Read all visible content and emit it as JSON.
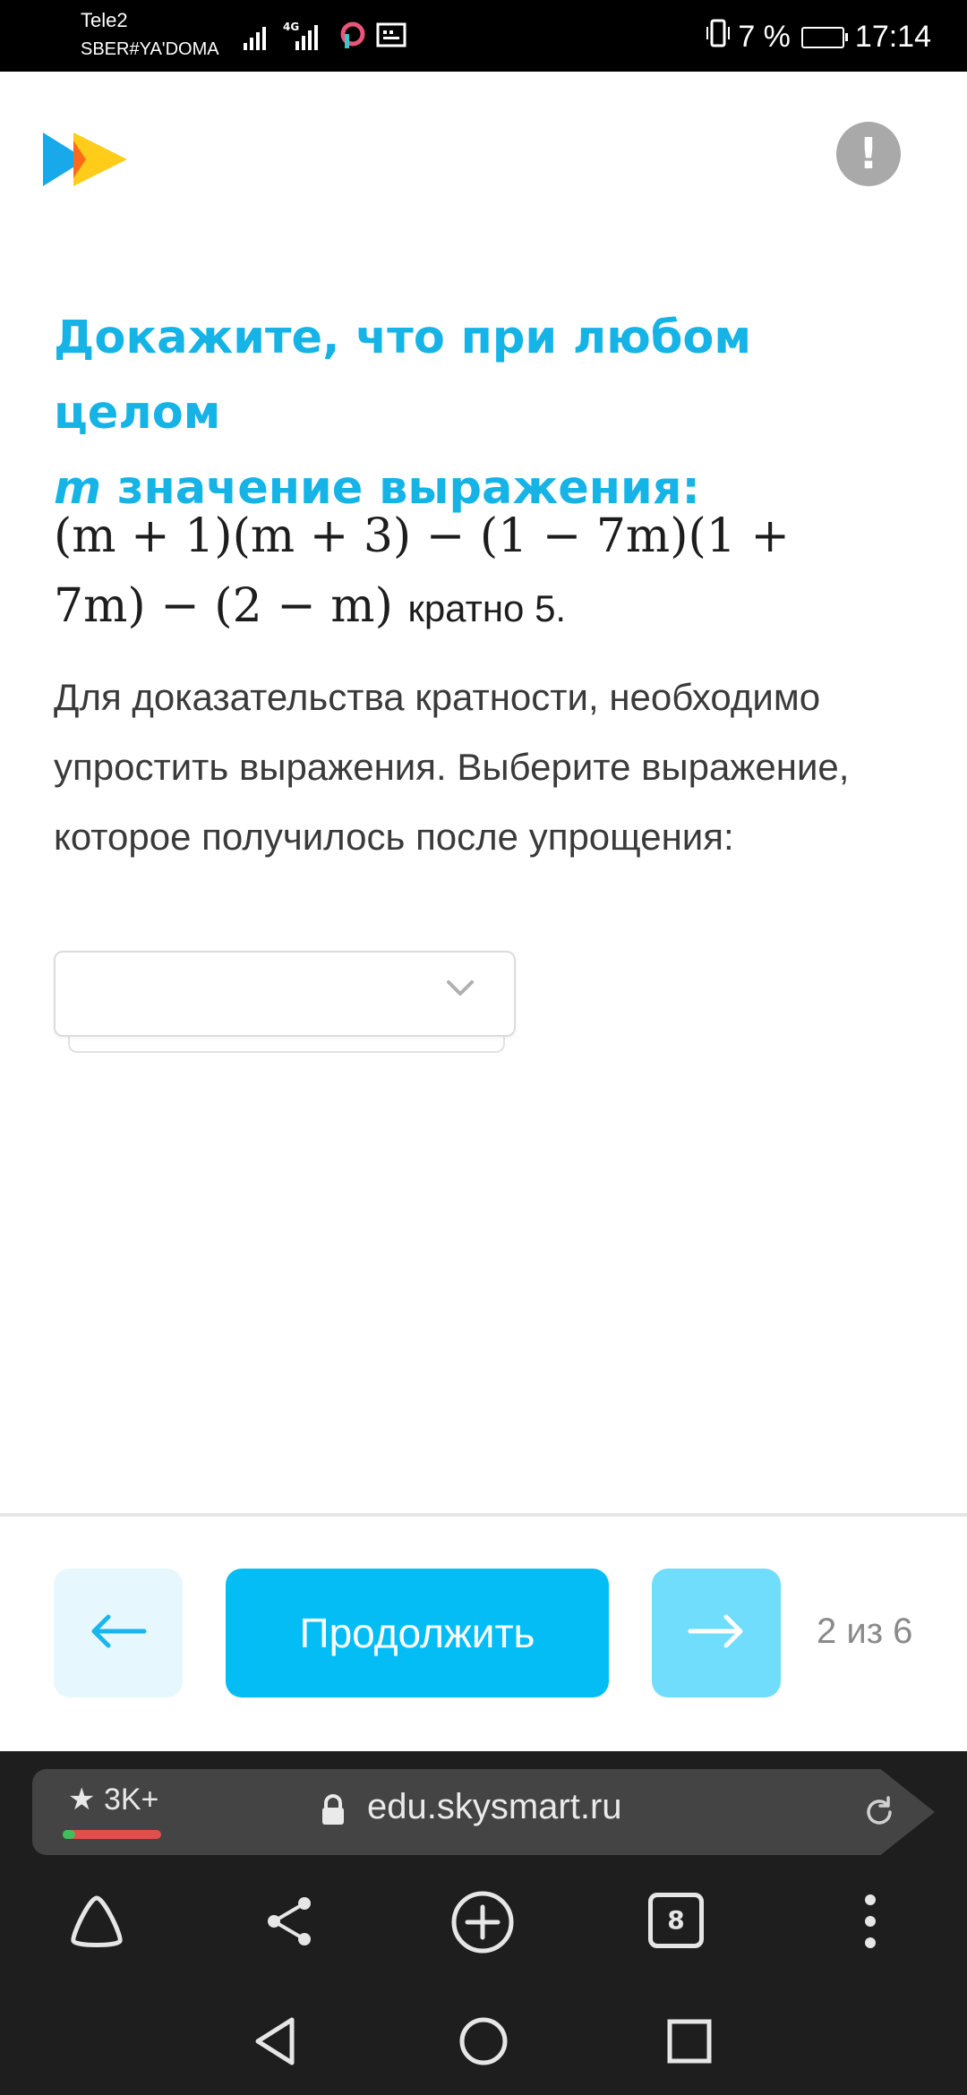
{
  "status_bar": {
    "carrier_line1": "Tele2",
    "carrier_line2": "SBER#YA'DOMA",
    "network": "4G",
    "battery": "7 %",
    "time": "17:14"
  },
  "question": {
    "title_line1": "Докажите, что при любом целом",
    "title_var": "m",
    "title_line2": "значение выражения:",
    "expression_line1": "(m + 1)(m + 3) − (1 − 7m)(1 +",
    "expression_line2": "7m) − (2 − m)",
    "expression_suffix": "кратно 5.",
    "description": "Для доказательства кратности, необходимо упростить выражения. Выберите выражение, которое получилось после упрощения:"
  },
  "answer_select": {
    "value": ""
  },
  "navigation": {
    "continue_label": "Продолжить",
    "progress": "2 из 6"
  },
  "browser": {
    "rating": "3K+",
    "url": "edu.skysmart.ru",
    "tabs_count": "8"
  },
  "colors": {
    "accent": "#05bdf5",
    "title": "#16b3e6"
  }
}
